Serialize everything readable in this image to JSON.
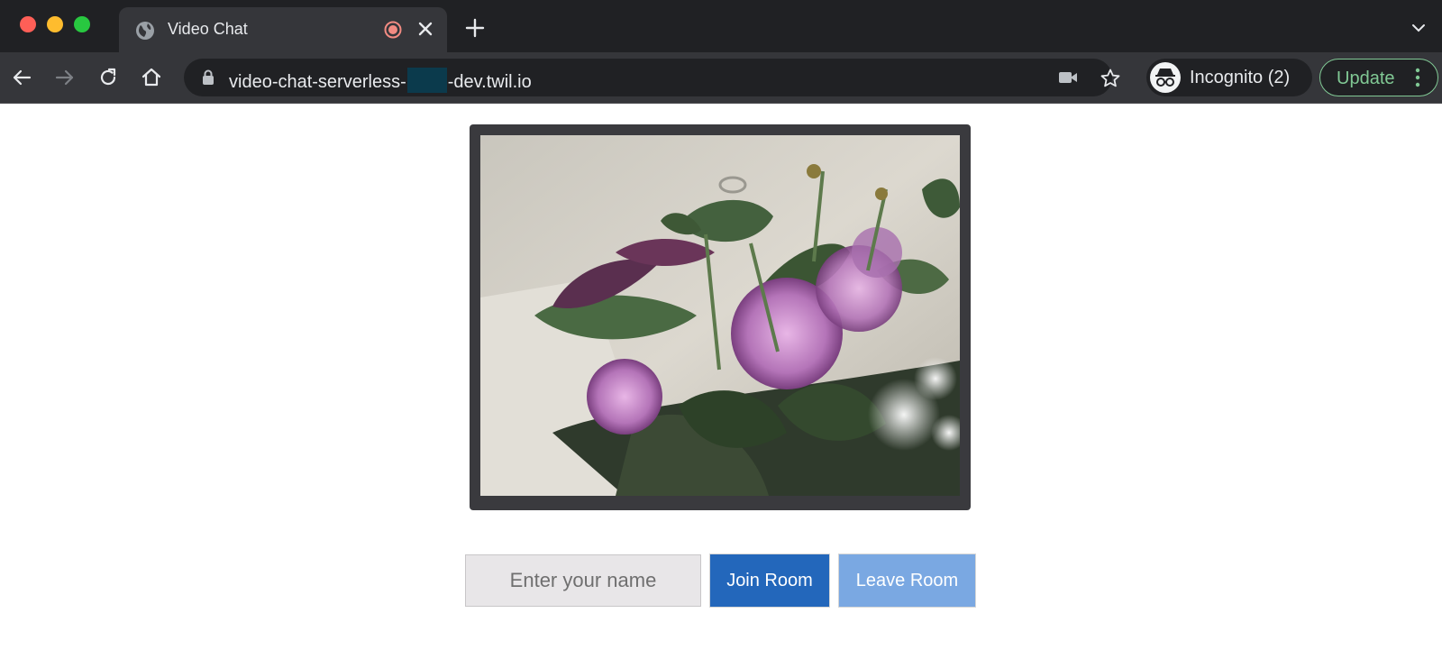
{
  "browser": {
    "tab": {
      "title": "Video Chat",
      "favicon": "globe-icon",
      "indicator": "recording-icon",
      "close": "close-icon"
    },
    "new_tab": "plus-icon",
    "tab_search": "chevron-down-icon",
    "nav": {
      "back": "back-arrow-icon",
      "forward": "forward-arrow-icon",
      "reload": "reload-icon",
      "home": "home-icon"
    },
    "address": {
      "url_start": "video-chat-serverless-",
      "url_end": "-dev.twil.io",
      "lock": "lock-icon",
      "camera": "camera-icon",
      "bookmark": "star-icon"
    },
    "profile": {
      "label": "Incognito (2)",
      "icon": "incognito-icon"
    },
    "update": {
      "label": "Update",
      "menu": "more-vert-icon"
    }
  },
  "page": {
    "name_input": {
      "placeholder": "Enter your name",
      "value": ""
    },
    "join_label": "Join Room",
    "leave_label": "Leave Room"
  },
  "colors": {
    "chrome_dark": "#202124",
    "chrome_tab": "#35363a",
    "update_green": "#81c995",
    "join_blue": "#2367bb",
    "leave_blue": "#7aa8e2",
    "video_border": "#3a3a3e"
  }
}
